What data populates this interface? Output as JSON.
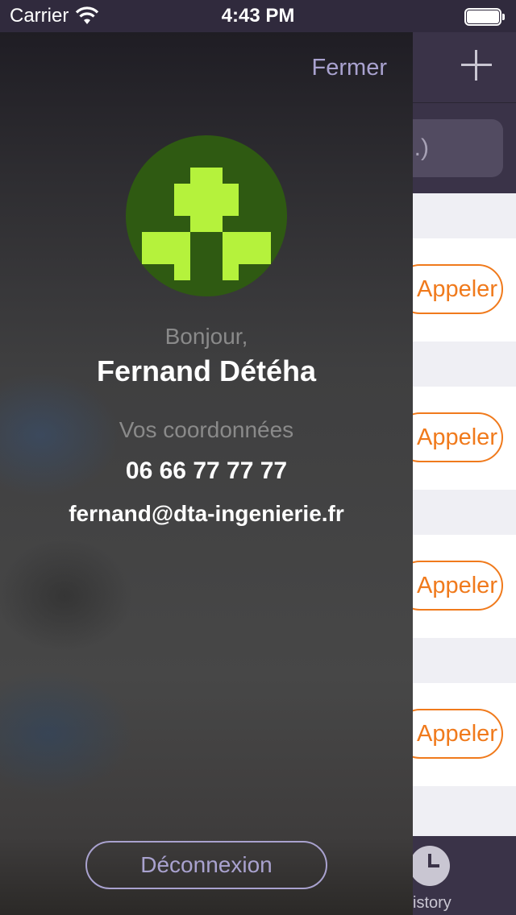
{
  "status_bar": {
    "carrier": "Carrier",
    "time": "4:43 PM"
  },
  "drawer": {
    "close_label": "Fermer",
    "greeting": "Bonjour,",
    "user_name": "Fernand Détéha",
    "contact_section_label": "Vos coordonnées",
    "phone": "06 66 77 77 77",
    "email": "fernand@dta-ingenierie.fr",
    "logout_label": "Déconnexion",
    "avatar_colors": {
      "background": "#2f5a12",
      "pattern": "#b5f23c"
    }
  },
  "underlay": {
    "search_placeholder_visible": ".)",
    "call_buttons": [
      "Appeler",
      "Appeler",
      "Appeler",
      "Appeler"
    ],
    "tab_history_label": "istory",
    "accent_color": "#f07a1c"
  },
  "icons": [
    "wifi-icon",
    "battery-icon",
    "add-icon",
    "history-icon",
    "avatar-identicon"
  ]
}
